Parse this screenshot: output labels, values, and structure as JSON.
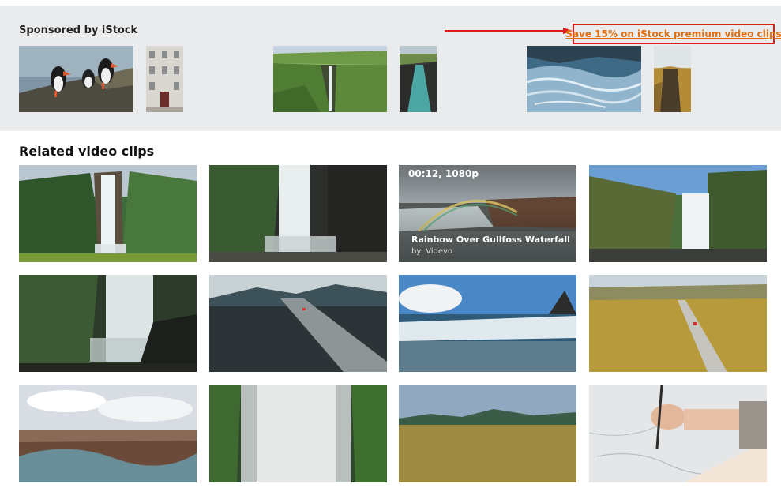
{
  "sponsored": {
    "title": "Sponsored by iStock",
    "promo_link": "Save 15% on iStock premium video clips",
    "thumbnails": [
      {
        "icon": "puffins-image"
      },
      {
        "icon": "building-image"
      },
      {
        "icon": "green-canyon-waterfall-image"
      },
      {
        "icon": "river-gorge-image"
      },
      {
        "icon": "glacier-image"
      },
      {
        "icon": "cliff-image"
      }
    ]
  },
  "related": {
    "title": "Related video clips",
    "hover_clip": {
      "meta": "00:12, 1080p",
      "title": "Rainbow Over Gullfoss Waterfall",
      "author": "by: Videvo"
    }
  },
  "colors": {
    "promo_border": "#e01b1b",
    "promo_text": "#e36e0e",
    "sponsored_bg": "#e9ebed"
  }
}
